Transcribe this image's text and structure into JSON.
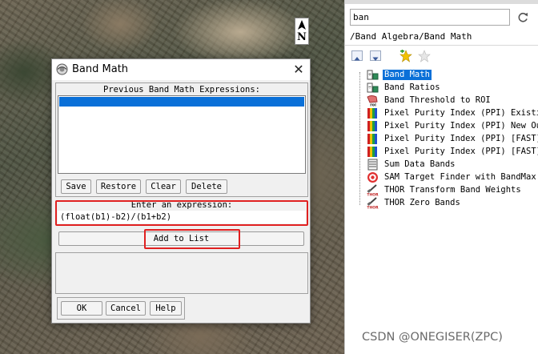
{
  "dialog": {
    "title": "Band Math",
    "close_glyph": "✕",
    "previous_label": "Previous Band Math Expressions:",
    "buttons": {
      "save": "Save",
      "restore": "Restore",
      "clear": "Clear",
      "delete": "Delete"
    },
    "expression_label": "Enter an expression:",
    "expression_value": "(float(b1)-b2)/(b1+b2)",
    "add_to_list": "Add to List",
    "footer": {
      "ok": "OK",
      "cancel": "Cancel",
      "help": "Help"
    }
  },
  "map": {
    "north_label": "N"
  },
  "toolbox": {
    "search_value": "ban",
    "path": "/Band Algebra/Band Math",
    "items": [
      {
        "label": "Band Math",
        "icon": "band-math-icon"
      },
      {
        "label": "Band Ratios",
        "icon": "band-math-icon"
      },
      {
        "label": "Band Threshold to ROI",
        "icon": "roi-icon"
      },
      {
        "label": "Pixel Purity Index (PPI) Existin",
        "icon": "ppi-icon"
      },
      {
        "label": "Pixel Purity Index (PPI) New Out",
        "icon": "ppi-icon"
      },
      {
        "label": "Pixel Purity Index (PPI) [FAST]",
        "icon": "ppi-icon"
      },
      {
        "label": "Pixel Purity Index (PPI) [FAST]",
        "icon": "ppi-icon"
      },
      {
        "label": "Sum Data Bands",
        "icon": "stack-icon"
      },
      {
        "label": "SAM Target Finder with BandMax",
        "icon": "target-icon"
      },
      {
        "label": "THOR Transform Band Weights",
        "icon": "thor-icon"
      },
      {
        "label": "THOR Zero Bands",
        "icon": "thor-icon"
      }
    ]
  },
  "watermark": "CSDN @ONEGISER(ZPC)",
  "colors": {
    "selection": "#0a70d8",
    "highlight": "#e02020"
  }
}
